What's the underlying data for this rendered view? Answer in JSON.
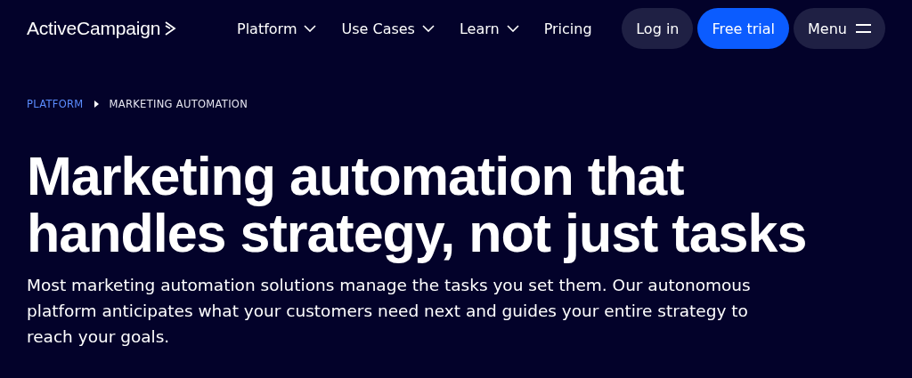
{
  "header": {
    "logo": "ActiveCampaign",
    "nav": [
      {
        "label": "Platform",
        "has_menu": true
      },
      {
        "label": "Use Cases",
        "has_menu": true
      },
      {
        "label": "Learn",
        "has_menu": true
      },
      {
        "label": "Pricing",
        "has_menu": false
      }
    ],
    "buttons": [
      {
        "label": "Log in",
        "kind": "secondary"
      },
      {
        "label": "Free trial",
        "kind": "primary"
      },
      {
        "label": "Menu",
        "kind": "menu"
      }
    ]
  },
  "breadcrumb": [
    {
      "label": "PLATFORM",
      "kind": "link"
    },
    {
      "label": "MARKETING AUTOMATION",
      "kind": "current"
    }
  ],
  "hero": {
    "title": "Marketing automation that handles strategy, not just tasks",
    "description": "Most marketing automation solutions manage the tasks you set them. Our autonomous platform anticipates what your customers need next and guides your entire strategy to reach your goals."
  }
}
